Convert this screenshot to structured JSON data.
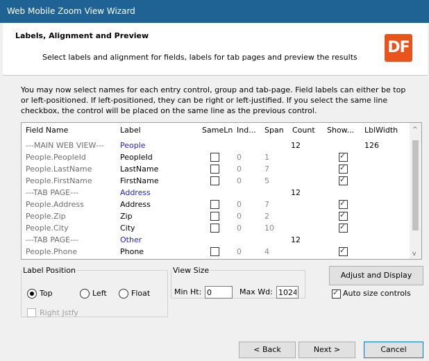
{
  "window": {
    "title": "Web Mobile Zoom View Wizard"
  },
  "header": {
    "title": "Labels, Alignment and Preview",
    "subtitle": "Select labels and alignment for fields, labels for tab pages and preview the results",
    "logo_text": "DF",
    "logo_color": "#e8541c"
  },
  "intro": {
    "line1": "You may now select names for each entry control, group and tab-page. Field labels can either be top",
    "line2": "or left-positioned. If left-positioned, they can be right or left-justified. If you select the same line",
    "line3": "checkbox, the control will be placed on the same line as the previous control."
  },
  "grid": {
    "columns": [
      "Field Name",
      "Label",
      "SameLn",
      "Ind...",
      "Span",
      "Count",
      "Show...",
      "LblWidth"
    ],
    "rows": [
      {
        "field": "---MAIN WEB VIEW---",
        "label": "People",
        "blue": true,
        "count": "12",
        "lblwidth": "126"
      },
      {
        "field": "People.PeopleId",
        "label": "PeopleId",
        "sameln": false,
        "ind": "0",
        "span": "1",
        "show": true
      },
      {
        "field": "People.LastName",
        "label": "LastName",
        "sameln": false,
        "ind": "0",
        "span": "7",
        "show": true
      },
      {
        "field": "People.FirstName",
        "label": "FirstName",
        "sameln": false,
        "ind": "0",
        "span": "5",
        "show": true
      },
      {
        "field": "---TAB PAGE---",
        "label": "Address",
        "blue": true,
        "count": "12"
      },
      {
        "field": "People.Address",
        "label": "Address",
        "sameln": false,
        "ind": "0",
        "span": "7",
        "show": true
      },
      {
        "field": "People.Zip",
        "label": "Zip",
        "sameln": false,
        "ind": "0",
        "span": "2",
        "show": true
      },
      {
        "field": "People.City",
        "label": "City",
        "sameln": false,
        "ind": "0",
        "span": "10",
        "show": true
      },
      {
        "field": "---TAB PAGE---",
        "label": "Other",
        "blue": true,
        "count": "12"
      },
      {
        "field": "People.Phone",
        "label": "Phone",
        "sameln": false,
        "ind": "0",
        "span": "4",
        "show": true
      }
    ]
  },
  "label_position": {
    "legend": "Label Position",
    "top": "Top",
    "left": "Left",
    "float": "Float",
    "selected": "Top",
    "right_justify": "Right Jstfy"
  },
  "view_size": {
    "legend": "View Size",
    "min_ht_label": "Min Ht:",
    "min_ht_value": "0",
    "max_wd_label": "Max Wd:",
    "max_wd_value": "1024"
  },
  "actions": {
    "adjust_display": "Adjust and Display",
    "auto_size": "Auto size controls",
    "auto_size_checked": true,
    "back": "< Back",
    "next": "Next >",
    "cancel": "Cancel"
  }
}
